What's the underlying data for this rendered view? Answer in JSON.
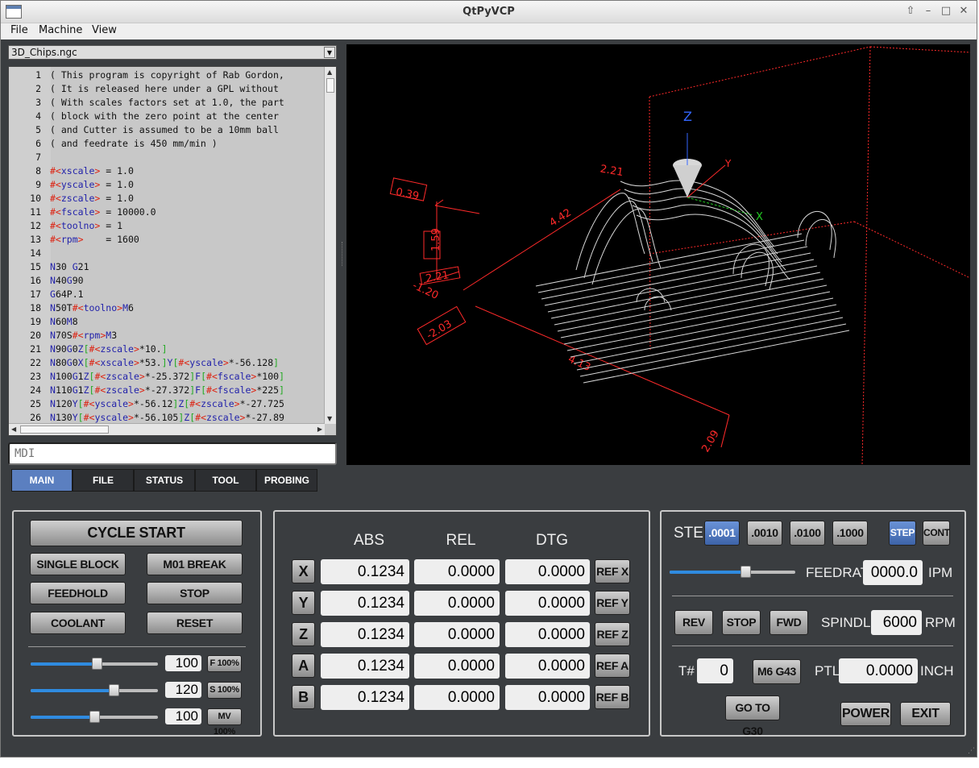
{
  "window": {
    "title": "QtPyVCP"
  },
  "menu": [
    "File",
    "Machine",
    "View"
  ],
  "file_combo": {
    "value": "3D_Chips.ngc"
  },
  "code_lines": [
    {
      "n": "1",
      "t": "( This program is copyright of Rab Gordon,"
    },
    {
      "n": "2",
      "t": "( It is released here under a GPL without"
    },
    {
      "n": "3",
      "t": "( With scales factors set at 1.0, the part"
    },
    {
      "n": "4",
      "t": "( block with the zero point at the center"
    },
    {
      "n": "5",
      "t": "( and Cutter is assumed to be a 10mm ball"
    },
    {
      "n": "6",
      "t": "( and feedrate is 450 mm/min )"
    },
    {
      "n": "7",
      "t": ""
    },
    {
      "n": "8",
      "t": "#<xscale> = 1.0"
    },
    {
      "n": "9",
      "t": "#<yscale> = 1.0"
    },
    {
      "n": "10",
      "t": "#<zscale> = 1.0"
    },
    {
      "n": "11",
      "t": "#<fscale> = 10000.0"
    },
    {
      "n": "12",
      "t": "#<toolno> = 1"
    },
    {
      "n": "13",
      "t": "#<rpm>    = 1600"
    },
    {
      "n": "14",
      "t": ""
    },
    {
      "n": "15",
      "t": "N30 G21"
    },
    {
      "n": "16",
      "t": "N40G90"
    },
    {
      "n": "17",
      "t": "G64P.1"
    },
    {
      "n": "18",
      "t": "N50T#<toolno>M6"
    },
    {
      "n": "19",
      "t": "N60M8"
    },
    {
      "n": "20",
      "t": "N70S#<rpm>M3"
    },
    {
      "n": "21",
      "t": "N90G0Z[#<zscale>*10.]"
    },
    {
      "n": "22",
      "t": "N80G0X[#<xscale>*53.]Y[#<yscale>*-56.128]"
    },
    {
      "n": "23",
      "t": "N100G1Z[#<zscale>*-25.372]F[#<fscale>*100]"
    },
    {
      "n": "24",
      "t": "N110G1Z[#<zscale>*-27.372]F[#<fscale>*225]"
    },
    {
      "n": "25",
      "t": "N120Y[#<yscale>*-56.12]Z[#<zscale>*-27.725"
    },
    {
      "n": "26",
      "t": "N130Y[#<yscale>*-56.105]Z[#<zscale>*-27.89"
    }
  ],
  "mdi": {
    "placeholder": "MDI"
  },
  "viewer": {
    "z_label": "Z",
    "y_label": "Y",
    "x_label": "X",
    "dims": [
      "0.39",
      "1.59",
      "2.21",
      "-1.20",
      "-2.03",
      "4.13",
      "2.09",
      "4.42",
      "2.21"
    ],
    "colors": {
      "extents": "#ff2a2a",
      "toolpath": "#d8d8d8",
      "z_axis": "#3366ff",
      "x_axis": "#22cc22"
    }
  },
  "tabs": [
    "MAIN",
    "FILE",
    "STATUS",
    "TOOL",
    "PROBING"
  ],
  "left_panel": {
    "cycle_start": "CYCLE START",
    "single_block": "SINGLE BLOCK",
    "m01_break": "M01 BREAK",
    "feedhold": "FEEDHOLD",
    "stop": "STOP",
    "coolant": "COOLANT",
    "reset": "RESET",
    "overrides": [
      {
        "value": "100",
        "button": "F 100%",
        "level": 0.52
      },
      {
        "value": "120",
        "button": "S 100%",
        "level": 0.65
      },
      {
        "value": "100",
        "button": "MV 100%",
        "level": 0.5
      }
    ]
  },
  "dro": {
    "headers": [
      "ABS",
      "REL",
      "DTG"
    ],
    "rows": [
      {
        "axis": "X",
        "abs": "0.1234",
        "rel": "0.0000",
        "dtg": "0.0000",
        "ref": "REF X"
      },
      {
        "axis": "Y",
        "abs": "0.1234",
        "rel": "0.0000",
        "dtg": "0.0000",
        "ref": "REF Y"
      },
      {
        "axis": "Z",
        "abs": "0.1234",
        "rel": "0.0000",
        "dtg": "0.0000",
        "ref": "REF Z"
      },
      {
        "axis": "A",
        "abs": "0.1234",
        "rel": "0.0000",
        "dtg": "0.0000",
        "ref": "REF A"
      },
      {
        "axis": "B",
        "abs": "0.1234",
        "rel": "0.0000",
        "dtg": "0.0000",
        "ref": "REF B"
      }
    ]
  },
  "right_panel": {
    "step_label": "STEP",
    "steps": [
      ".0001",
      ".0010",
      ".0100",
      ".1000"
    ],
    "step_btn": "STEP",
    "cont_btn": "CONT",
    "feedrate_label": "FEEDRATE",
    "feedrate_value": "0000.0",
    "feedrate_unit": "IPM",
    "jog_level": 0.6,
    "rev": "REV",
    "spindle_stop": "STOP",
    "fwd": "FWD",
    "spindle_label": "SPINDLE",
    "spindle_value": "6000",
    "spindle_unit": "RPM",
    "tool_label": "T#",
    "tool_value": "0",
    "m6g43": "M6 G43",
    "ptl_label": "PTL",
    "ptl_value": "0.0000",
    "ptl_unit": "INCH",
    "go_to_g30": "GO TO G30",
    "power": "POWER",
    "exit": "EXIT"
  }
}
